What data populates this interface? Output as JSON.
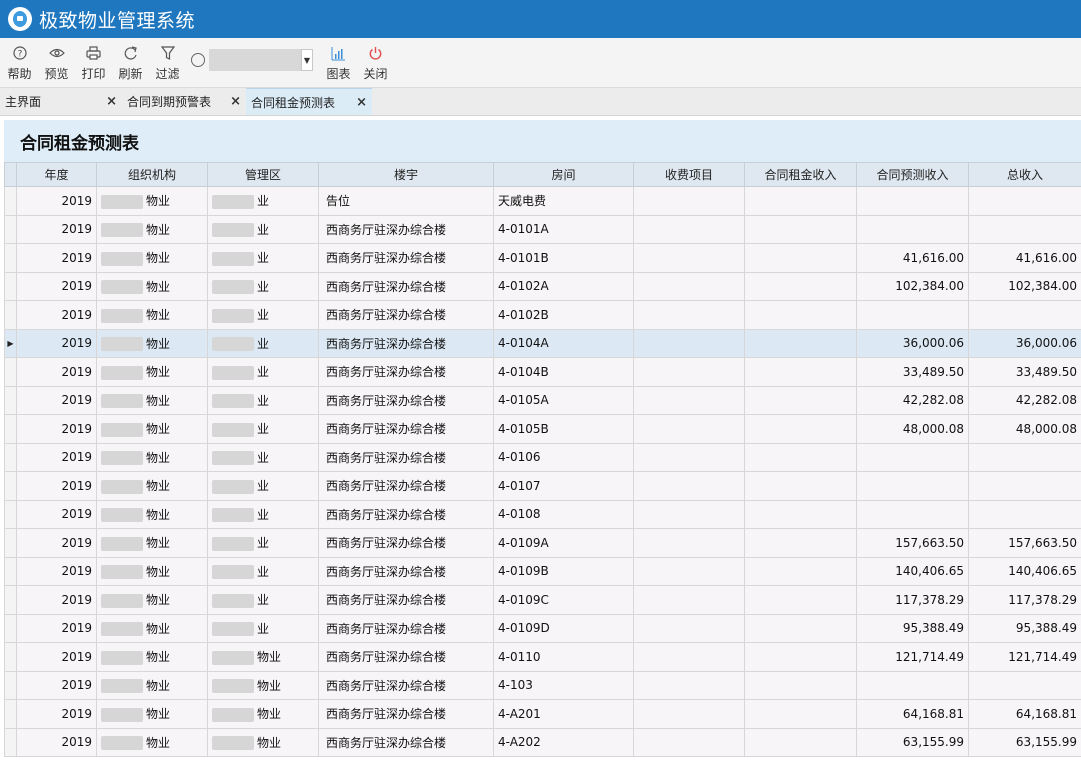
{
  "app": {
    "title": "极致物业管理系统"
  },
  "toolbar": {
    "help": "帮助",
    "preview": "预览",
    "print": "打印",
    "refresh": "刷新",
    "filter": "过滤",
    "search_value": "",
    "chart": "图表",
    "close": "关闭"
  },
  "tabs": [
    {
      "label": "主界面",
      "active": false
    },
    {
      "label": "合同到期预警表",
      "active": false
    },
    {
      "label": "合同租金预测表",
      "active": true
    }
  ],
  "report": {
    "title": "合同租金预测表",
    "columns": [
      "年度",
      "组织机构",
      "管理区",
      "楼宇",
      "房间",
      "收费项目",
      "合同租金收入",
      "合同预测收入",
      "总收入"
    ],
    "rows": [
      {
        "year": "2019",
        "org": "物业",
        "area": "业",
        "building": "告位",
        "room": "天威电费",
        "item": "",
        "rent": "",
        "forecast": "",
        "total": ""
      },
      {
        "year": "2019",
        "org": "物业",
        "area": "业",
        "building": "西商务厅驻深办综合楼",
        "room": "4-0101A",
        "item": "",
        "rent": "",
        "forecast": "",
        "total": ""
      },
      {
        "year": "2019",
        "org": "物业",
        "area": "业",
        "building": "西商务厅驻深办综合楼",
        "room": "4-0101B",
        "item": "",
        "rent": "",
        "forecast": "41,616.00",
        "total": "41,616.00"
      },
      {
        "year": "2019",
        "org": "物业",
        "area": "业",
        "building": "西商务厅驻深办综合楼",
        "room": "4-0102A",
        "item": "",
        "rent": "",
        "forecast": "102,384.00",
        "total": "102,384.00"
      },
      {
        "year": "2019",
        "org": "物业",
        "area": "业",
        "building": "西商务厅驻深办综合楼",
        "room": "4-0102B",
        "item": "",
        "rent": "",
        "forecast": "",
        "total": ""
      },
      {
        "year": "2019",
        "org": "物业",
        "area": "业",
        "building": "西商务厅驻深办综合楼",
        "room": "4-0104A",
        "item": "",
        "rent": "",
        "forecast": "36,000.06",
        "total": "36,000.06",
        "selected": true
      },
      {
        "year": "2019",
        "org": "物业",
        "area": "业",
        "building": "西商务厅驻深办综合楼",
        "room": "4-0104B",
        "item": "",
        "rent": "",
        "forecast": "33,489.50",
        "total": "33,489.50"
      },
      {
        "year": "2019",
        "org": "物业",
        "area": "业",
        "building": "西商务厅驻深办综合楼",
        "room": "4-0105A",
        "item": "",
        "rent": "",
        "forecast": "42,282.08",
        "total": "42,282.08"
      },
      {
        "year": "2019",
        "org": "物业",
        "area": "业",
        "building": "西商务厅驻深办综合楼",
        "room": "4-0105B",
        "item": "",
        "rent": "",
        "forecast": "48,000.08",
        "total": "48,000.08"
      },
      {
        "year": "2019",
        "org": "物业",
        "area": "业",
        "building": "西商务厅驻深办综合楼",
        "room": "4-0106",
        "item": "",
        "rent": "",
        "forecast": "",
        "total": ""
      },
      {
        "year": "2019",
        "org": "物业",
        "area": "业",
        "building": "西商务厅驻深办综合楼",
        "room": "4-0107",
        "item": "",
        "rent": "",
        "forecast": "",
        "total": ""
      },
      {
        "year": "2019",
        "org": "物业",
        "area": "业",
        "building": "西商务厅驻深办综合楼",
        "room": "4-0108",
        "item": "",
        "rent": "",
        "forecast": "",
        "total": ""
      },
      {
        "year": "2019",
        "org": "物业",
        "area": "业",
        "building": "西商务厅驻深办综合楼",
        "room": "4-0109A",
        "item": "",
        "rent": "",
        "forecast": "157,663.50",
        "total": "157,663.50"
      },
      {
        "year": "2019",
        "org": "物业",
        "area": "业",
        "building": "西商务厅驻深办综合楼",
        "room": "4-0109B",
        "item": "",
        "rent": "",
        "forecast": "140,406.65",
        "total": "140,406.65"
      },
      {
        "year": "2019",
        "org": "物业",
        "area": "业",
        "building": "西商务厅驻深办综合楼",
        "room": "4-0109C",
        "item": "",
        "rent": "",
        "forecast": "117,378.29",
        "total": "117,378.29"
      },
      {
        "year": "2019",
        "org": "物业",
        "area": "业",
        "building": "西商务厅驻深办综合楼",
        "room": "4-0109D",
        "item": "",
        "rent": "",
        "forecast": "95,388.49",
        "total": "95,388.49"
      },
      {
        "year": "2019",
        "org": "物业",
        "area": "物业",
        "building": "西商务厅驻深办综合楼",
        "room": "4-0110",
        "item": "",
        "rent": "",
        "forecast": "121,714.49",
        "total": "121,714.49"
      },
      {
        "year": "2019",
        "org": "物业",
        "area": "物业",
        "building": "西商务厅驻深办综合楼",
        "room": "4-103",
        "item": "",
        "rent": "",
        "forecast": "",
        "total": ""
      },
      {
        "year": "2019",
        "org": "物业",
        "area": "物业",
        "building": "西商务厅驻深办综合楼",
        "room": "4-A201",
        "item": "",
        "rent": "",
        "forecast": "64,168.81",
        "total": "64,168.81"
      },
      {
        "year": "2019",
        "org": "物业",
        "area": "物业",
        "building": "西商务厅驻深办综合楼",
        "room": "4-A202",
        "item": "",
        "rent": "",
        "forecast": "63,155.99",
        "total": "63,155.99"
      }
    ]
  },
  "colors": {
    "titlebar": "#1f77bf",
    "selected_row": "#dce9f5",
    "close_icon": "#e05050",
    "chart_icon": "#3a8ed8"
  },
  "icons": {
    "help": "question-circle-icon",
    "preview": "eye-icon",
    "print": "printer-icon",
    "refresh": "refresh-icon",
    "filter": "funnel-icon",
    "search": "search-icon",
    "chart": "bar-chart-icon",
    "close": "power-icon"
  }
}
